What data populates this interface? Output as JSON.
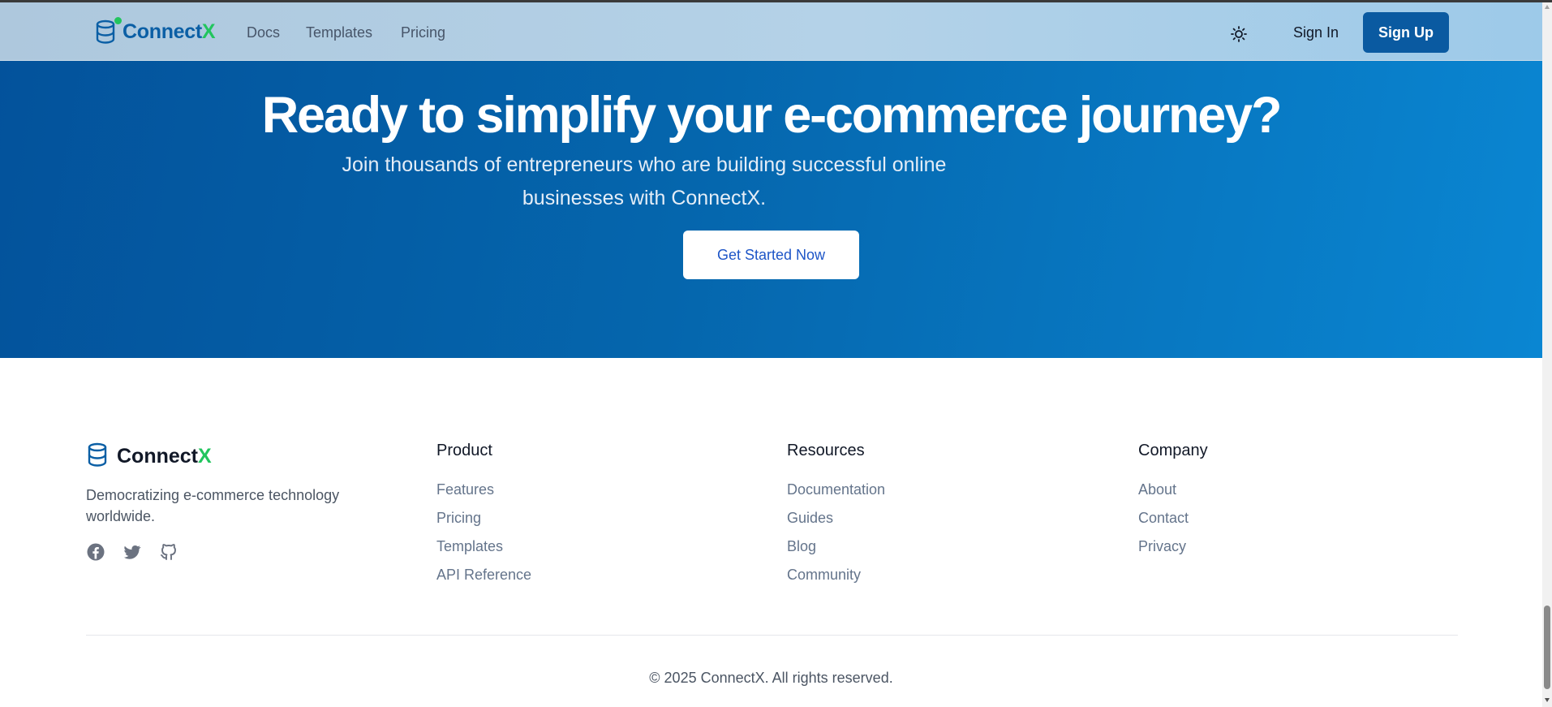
{
  "nav": {
    "brand_main": "Connect",
    "brand_accent": "X",
    "links": [
      "Docs",
      "Templates",
      "Pricing"
    ],
    "sign_in": "Sign In",
    "sign_up": "Sign Up"
  },
  "hero": {
    "title": "Ready to simplify your e-commerce journey?",
    "subtitle": "Join thousands of entrepreneurs who are building successful online businesses with ConnectX.",
    "cta": "Get Started Now"
  },
  "footer": {
    "brand_main": "Connect",
    "brand_accent": "X",
    "tagline": "Democratizing e-commerce technology worldwide.",
    "social": [
      "facebook-icon",
      "twitter-icon",
      "github-icon"
    ],
    "columns": [
      {
        "heading": "Product",
        "links": [
          "Features",
          "Pricing",
          "Templates",
          "API Reference"
        ]
      },
      {
        "heading": "Resources",
        "links": [
          "Documentation",
          "Guides",
          "Blog",
          "Community"
        ]
      },
      {
        "heading": "Company",
        "links": [
          "About",
          "Contact",
          "Privacy"
        ]
      }
    ],
    "copyright": "© 2025 ConnectX. All rights reserved."
  },
  "colors": {
    "brand_blue": "#0b5fa5",
    "brand_green": "#22c55e",
    "cta_text": "#1d55c7"
  }
}
